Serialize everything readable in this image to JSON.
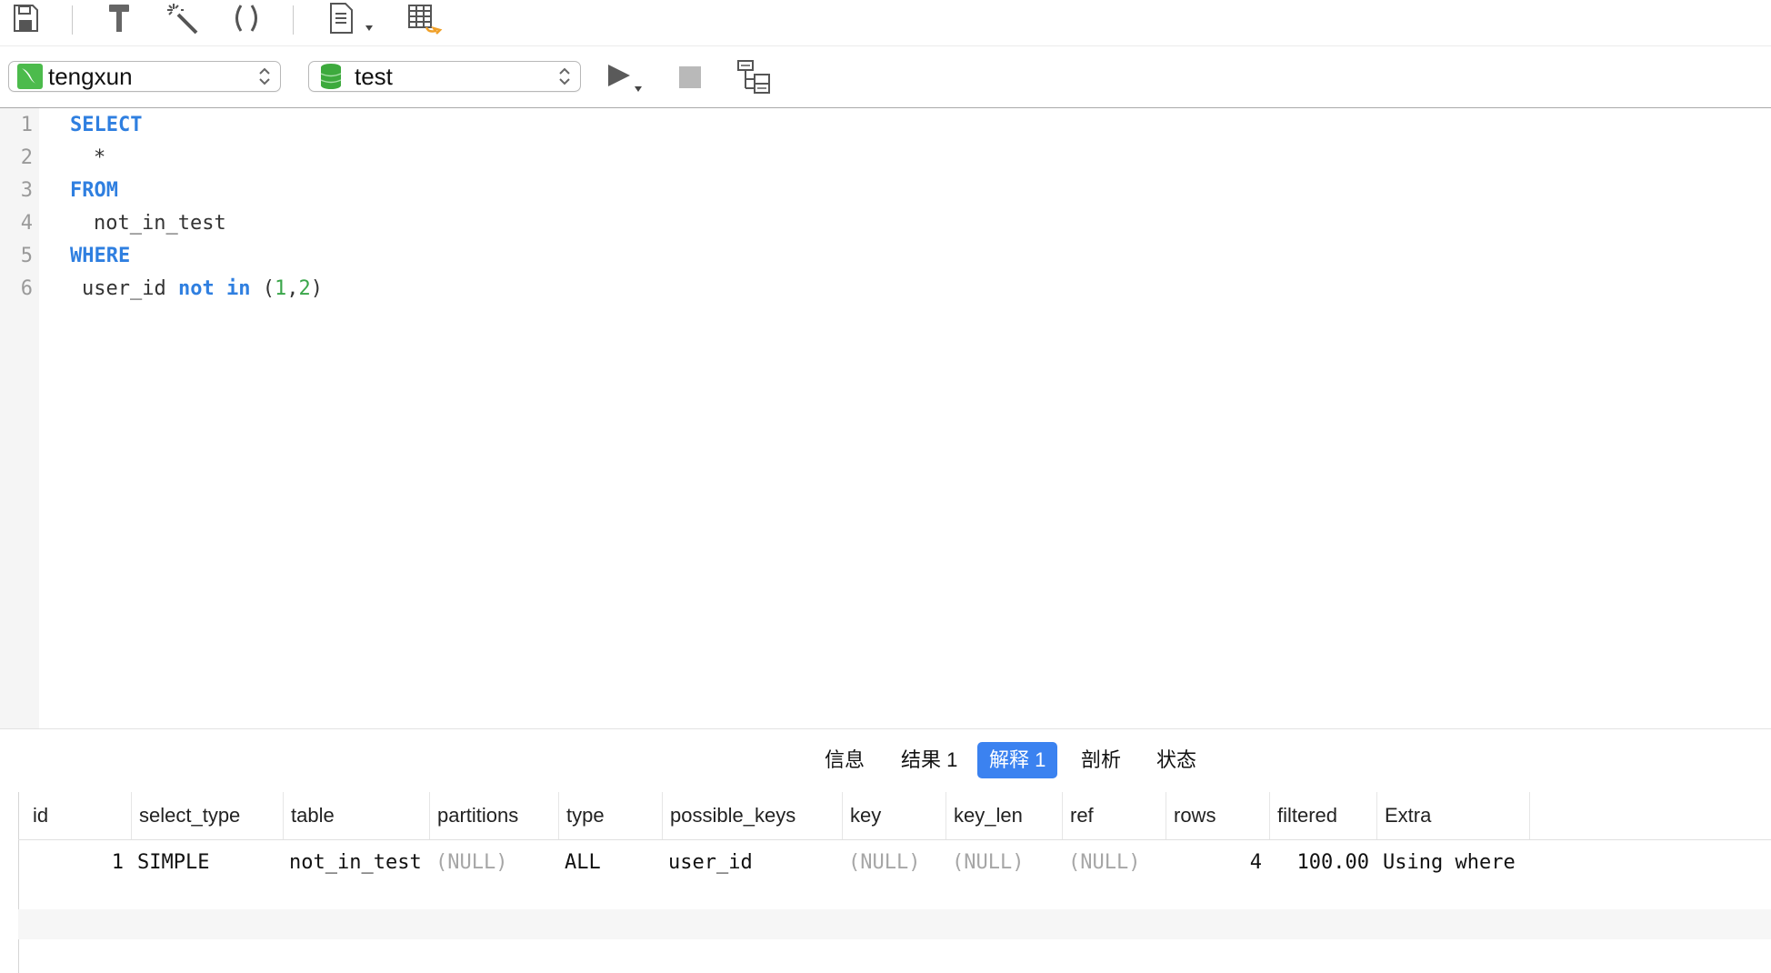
{
  "toolbar": {
    "icons": [
      "save-icon",
      "beautify-hammer-icon",
      "magic-wand-icon",
      "parentheses-icon",
      "document-icon",
      "export-grid-icon"
    ]
  },
  "connection": {
    "name": "tengxun",
    "icon": "mysql-connection-icon"
  },
  "database": {
    "name": "test",
    "icon": "database-icon"
  },
  "editor": {
    "line_numbers": [
      "1",
      "2",
      "3",
      "4",
      "5",
      "6"
    ],
    "lines": {
      "l1": {
        "kw": "SELECT"
      },
      "l2": {
        "text": "*"
      },
      "l3": {
        "kw": "FROM"
      },
      "l4": {
        "text": "not_in_test"
      },
      "l5": {
        "kw": "WHERE"
      },
      "l6": {
        "col": "user_id",
        "kw1": "not",
        "kw2": "in",
        "open": "(",
        "n1": "1",
        "comma": ",",
        "n2": "2",
        "close": ")"
      }
    }
  },
  "result_tabs": [
    "信息",
    "结果 1",
    "解释 1",
    "剖析",
    "状态"
  ],
  "active_tab": "解释 1",
  "grid": {
    "columns": [
      "id",
      "select_type",
      "table",
      "partitions",
      "type",
      "possible_keys",
      "key",
      "key_len",
      "ref",
      "rows",
      "filtered",
      "Extra"
    ],
    "rows": [
      {
        "id": "1",
        "select_type": "SIMPLE",
        "table": "not_in_test",
        "partitions": "(NULL)",
        "type": "ALL",
        "possible_keys": "user_id",
        "key": "(NULL)",
        "key_len": "(NULL)",
        "ref": "(NULL)",
        "rows": "4",
        "filtered": "100.00",
        "Extra": "Using where"
      }
    ]
  },
  "colors": {
    "keyword": "#2f7fe0",
    "number": "#3aa64a",
    "active_tab": "#3b82f0",
    "null_text": "#a6a6a6"
  }
}
